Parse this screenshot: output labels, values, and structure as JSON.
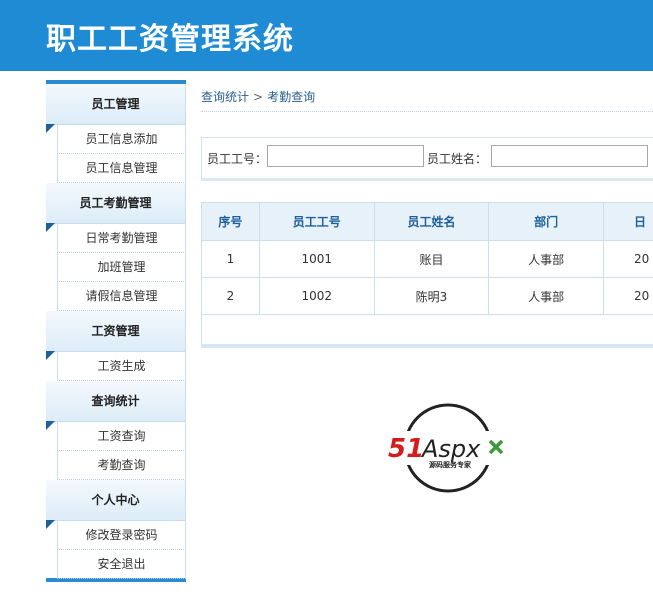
{
  "header": {
    "title": "职工工资管理系统"
  },
  "sidebar": {
    "groups": [
      {
        "title": "员工管理",
        "items": [
          "员工信息添加",
          "员工信息管理"
        ]
      },
      {
        "title": "员工考勤管理",
        "items": [
          "日常考勤管理",
          "加班管理",
          "请假信息管理"
        ]
      },
      {
        "title": "工资管理",
        "items": [
          "工资生成"
        ]
      },
      {
        "title": "查询统计",
        "items": [
          "工资查询",
          "考勤查询"
        ]
      },
      {
        "title": "个人中心",
        "items": [
          "修改登录密码",
          "安全退出"
        ]
      }
    ]
  },
  "breadcrumb": {
    "parent": "查询统计",
    "separator": ">",
    "current": "考勤查询"
  },
  "search": {
    "emp_id_label": "员工工号：",
    "emp_name_label": "员工姓名：",
    "emp_id_value": "",
    "emp_name_value": ""
  },
  "table": {
    "headers": [
      "序号",
      "员工工号",
      "员工姓名",
      "部门",
      "日"
    ],
    "rows": [
      [
        "1",
        "1001",
        "账目",
        "人事部",
        "20"
      ],
      [
        "2",
        "1002",
        "陈明3",
        "人事部",
        "20"
      ]
    ]
  },
  "logo": {
    "brand": "51Aspx",
    "tagline": "源码服务专家"
  },
  "colors": {
    "header_bg": "#1f8bd4",
    "accent": "#2a8bd0",
    "logo_red": "#d51c1c",
    "logo_green": "#3c9a3c"
  }
}
